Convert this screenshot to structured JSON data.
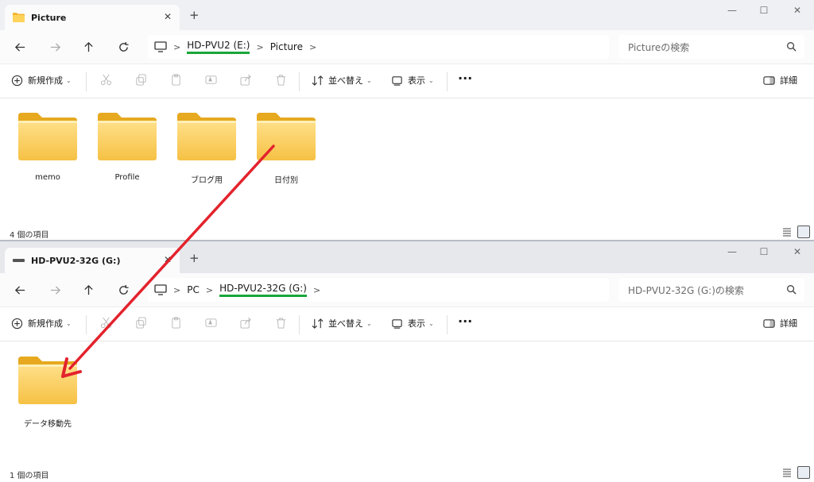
{
  "window1": {
    "tab_title": "Picture",
    "breadcrumb": [
      "HD-PVU2 (E:)",
      "Picture"
    ],
    "search_placeholder": "Pictureの検索",
    "toolbar": {
      "new_label": "新規作成",
      "sort_label": "並べ替え",
      "view_label": "表示",
      "details_label": "詳細"
    },
    "folders": [
      "memo",
      "Profile",
      "ブログ用",
      "日付別"
    ],
    "status": "4 個の項目"
  },
  "window2": {
    "tab_title": "HD-PVU2-32G (G:)",
    "breadcrumb": [
      "PC",
      "HD-PVU2-32G (G:)"
    ],
    "search_placeholder": "HD-PVU2-32G (G:)の検索",
    "toolbar": {
      "new_label": "新規作成",
      "sort_label": "並べ替え",
      "view_label": "表示",
      "details_label": "詳細"
    },
    "folders": [
      "データ移動先"
    ],
    "status": "1 個の項目"
  },
  "colors": {
    "highlight_underline": "#1aa63a",
    "arrow": "#e3232d",
    "folder": "#f7c948"
  },
  "icons": {
    "tab1": "folder-icon",
    "tab2": "drive-icon",
    "back": "arrow-left-icon",
    "forward": "arrow-right-icon",
    "up": "arrow-up-icon",
    "refresh": "refresh-icon",
    "pc": "monitor-icon",
    "search": "search-icon",
    "cut": "scissors-icon",
    "copy": "copy-icon",
    "paste": "clipboard-icon",
    "rename": "rename-icon",
    "share": "share-icon",
    "delete": "trash-icon",
    "more": "ellipsis-icon"
  }
}
